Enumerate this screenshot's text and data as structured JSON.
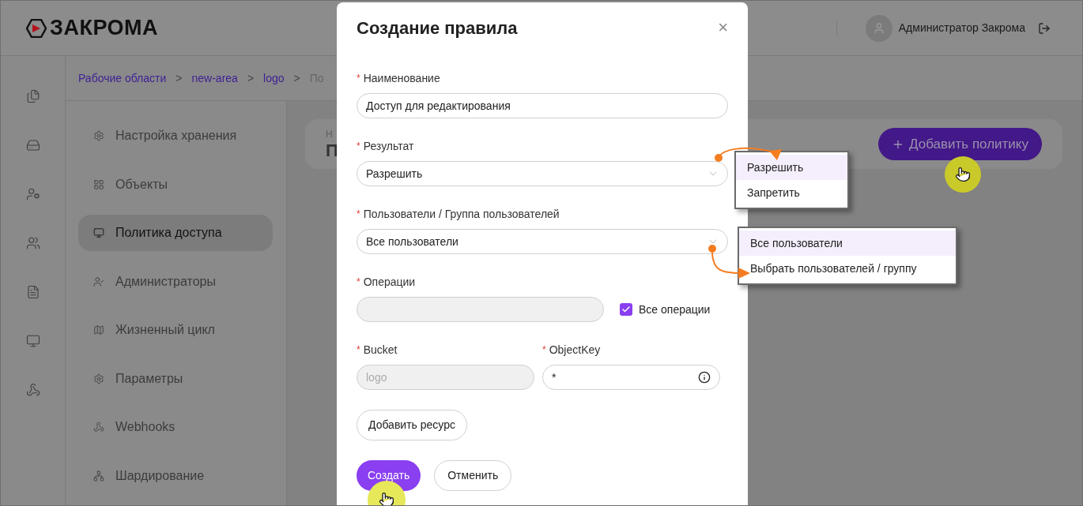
{
  "header": {
    "logo": "ЗАКРОМА",
    "user": "Администратор Закрома"
  },
  "breadcrumb": {
    "separator": ">",
    "items": [
      {
        "label": "Рабочие области",
        "link": true
      },
      {
        "label": "new-area",
        "link": true
      },
      {
        "label": "logo",
        "link": true
      },
      {
        "label": "По",
        "link": false
      }
    ]
  },
  "nav": [
    {
      "label": "Настройка хранения",
      "selected": false
    },
    {
      "label": "Объекты",
      "selected": false
    },
    {
      "label": "Политика доступа",
      "selected": true
    },
    {
      "label": "Администраторы",
      "selected": false
    },
    {
      "label": "Жизненный цикл",
      "selected": false
    },
    {
      "label": "Параметры",
      "selected": false
    },
    {
      "label": "Webhooks",
      "selected": false
    },
    {
      "label": "Шардирование",
      "selected": false
    }
  ],
  "page_card": {
    "label": "Н",
    "title": "П",
    "add_button": "Добавить политику"
  },
  "modal": {
    "title": "Создание правила",
    "close": "×",
    "fields": [
      {
        "kind": "text",
        "label": "Наименование",
        "required": true,
        "value": "Доступ для редактирования"
      },
      {
        "kind": "select",
        "label": "Результат",
        "required": true,
        "value": "Разрешить"
      },
      {
        "kind": "select",
        "label": "Пользователи / Группа пользователей",
        "required": true,
        "value": "Все пользователи"
      },
      {
        "kind": "checkbox_field",
        "label": "Операции",
        "required": true,
        "disabled": true,
        "checkbox": {
          "label": "Все операции",
          "checked": true
        }
      },
      {
        "kind": "pair",
        "items": [
          {
            "label": "Bucket",
            "required": true,
            "placeholder": "logo",
            "disabled": true,
            "info": false
          },
          {
            "label": "ObjectKey",
            "required": true,
            "value": "*",
            "disabled": false,
            "info": true
          }
        ]
      }
    ],
    "add_resource": "Добавить ресурс",
    "submit": "Создать",
    "cancel": "Отменить"
  },
  "result_options": [
    {
      "label": "Разрешить",
      "selected": true
    },
    {
      "label": "Запретить",
      "selected": false
    }
  ],
  "user_options": [
    {
      "label": "Все пользователи",
      "selected": true
    },
    {
      "label": "Выбрать пользователей / группу",
      "selected": false
    }
  ]
}
